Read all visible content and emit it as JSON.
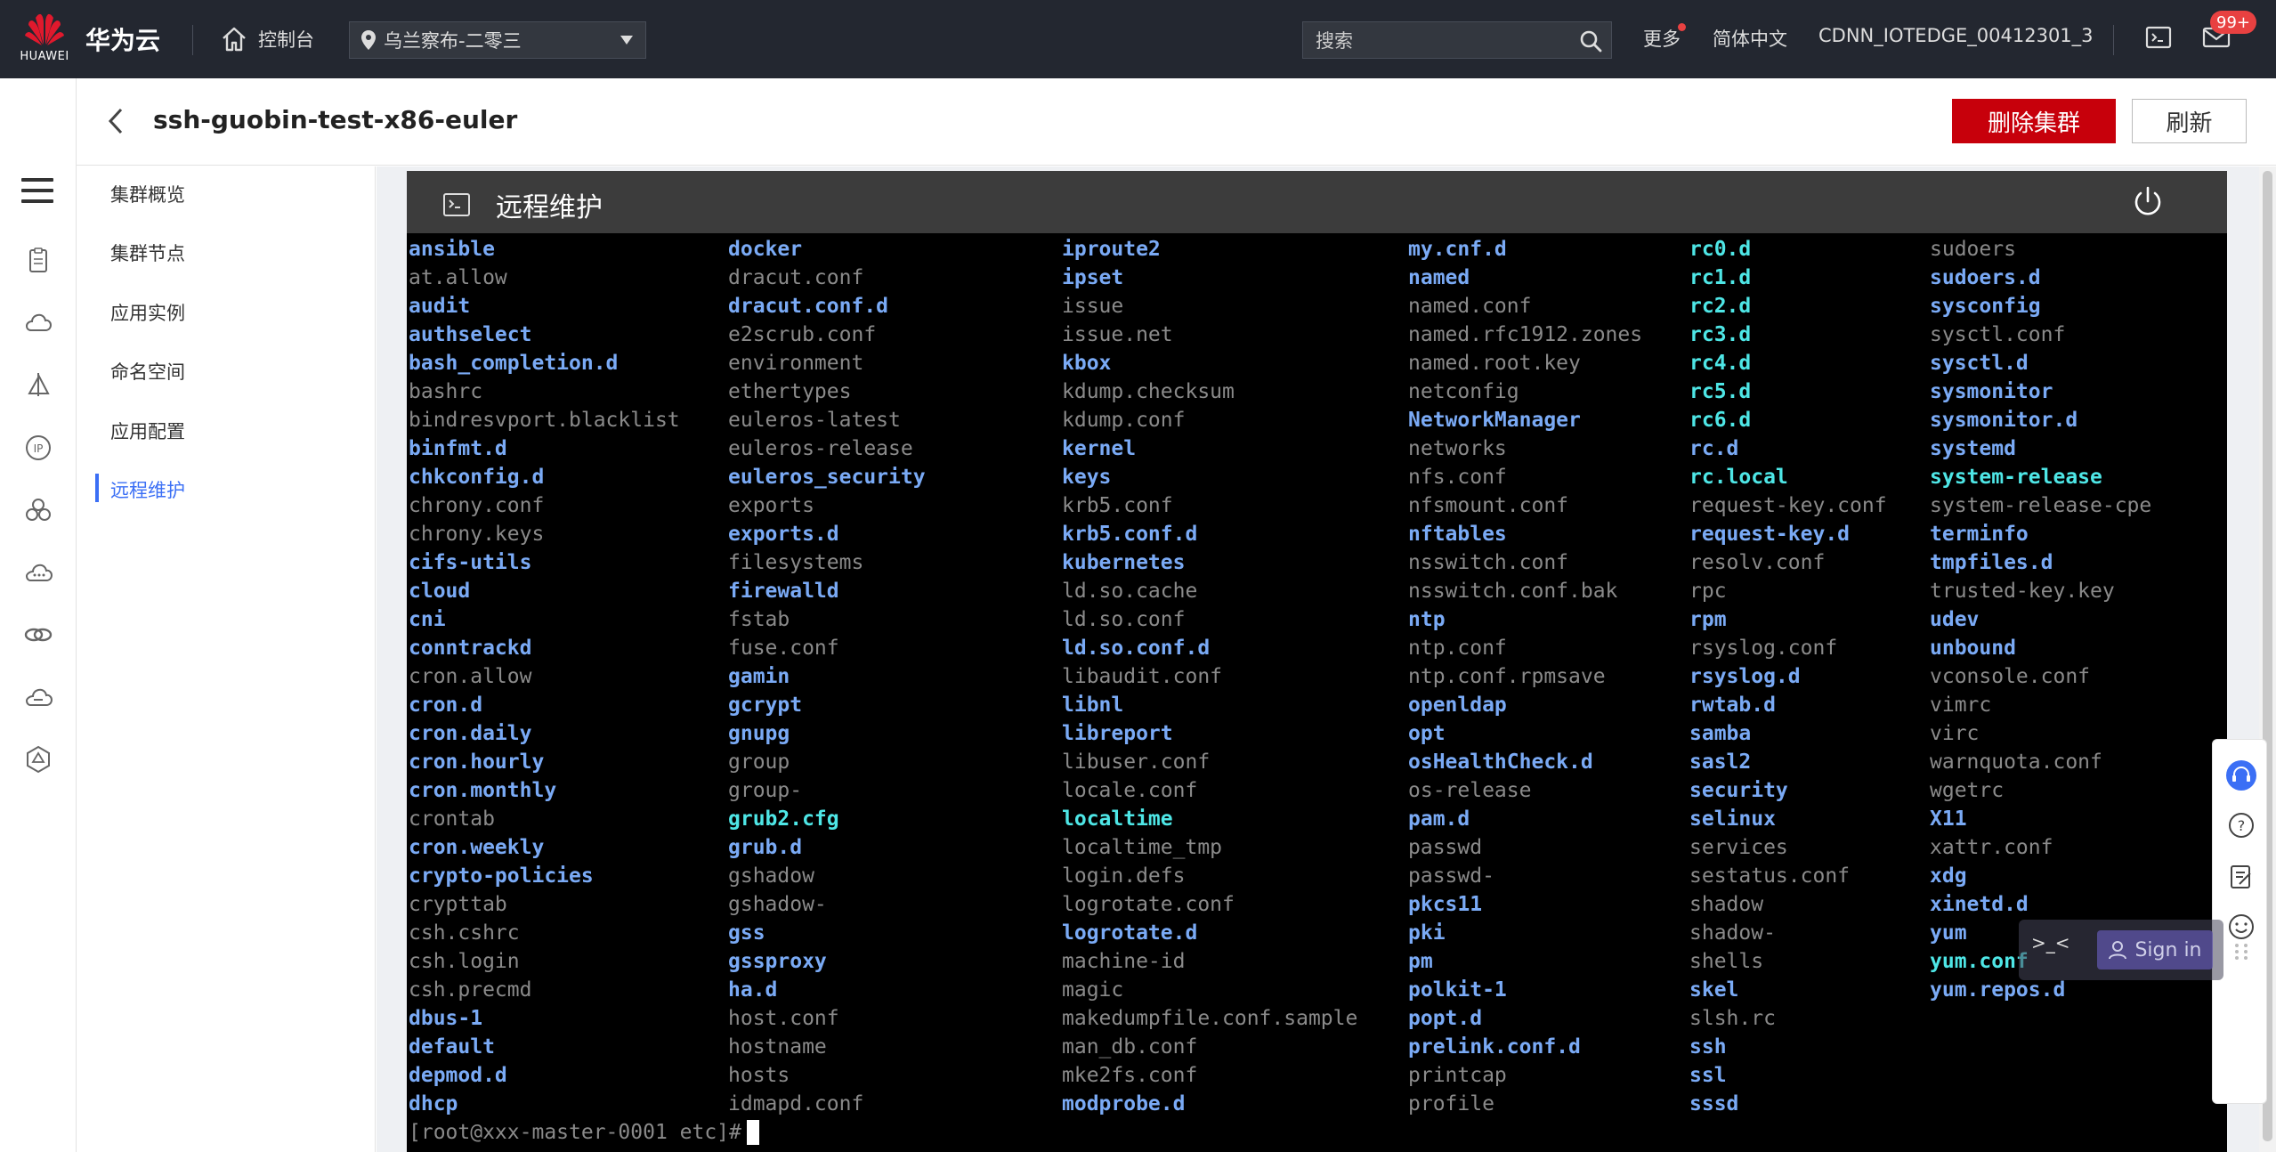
{
  "topbar": {
    "brand_text": "HUAWEI",
    "product": "华为云",
    "console_label": "控制台",
    "region": "乌兰察布-二零三",
    "search_placeholder": "搜索",
    "more_label": "更多",
    "language": "简体中文",
    "account": "CDNN_IOTEDGE_00412301_3",
    "mail_badge": "99+"
  },
  "header": {
    "title": "ssh-guobin-test-x86-euler",
    "delete_button": "删除集群",
    "refresh_button": "刷新"
  },
  "subnav": {
    "items": [
      "集群概览",
      "集群节点",
      "应用实例",
      "命名空间",
      "应用配置",
      "远程维护"
    ],
    "active_index": 5
  },
  "terminal": {
    "panel_title": "远程维护",
    "columns": [
      [
        {
          "name": "ansible",
          "kind": "d"
        },
        {
          "name": "at.allow",
          "kind": "f"
        },
        {
          "name": "audit",
          "kind": "d"
        },
        {
          "name": "authselect",
          "kind": "d"
        },
        {
          "name": "bash_completion.d",
          "kind": "d"
        },
        {
          "name": "bashrc",
          "kind": "f"
        },
        {
          "name": "bindresvport.blacklist",
          "kind": "f"
        },
        {
          "name": "binfmt.d",
          "kind": "d"
        },
        {
          "name": "chkconfig.d",
          "kind": "d"
        },
        {
          "name": "chrony.conf",
          "kind": "f"
        },
        {
          "name": "chrony.keys",
          "kind": "f"
        },
        {
          "name": "cifs-utils",
          "kind": "d"
        },
        {
          "name": "cloud",
          "kind": "d"
        },
        {
          "name": "cni",
          "kind": "d"
        },
        {
          "name": "conntrackd",
          "kind": "d"
        },
        {
          "name": "cron.allow",
          "kind": "f"
        },
        {
          "name": "cron.d",
          "kind": "d"
        },
        {
          "name": "cron.daily",
          "kind": "d"
        },
        {
          "name": "cron.hourly",
          "kind": "d"
        },
        {
          "name": "cron.monthly",
          "kind": "d"
        },
        {
          "name": "crontab",
          "kind": "f"
        },
        {
          "name": "cron.weekly",
          "kind": "d"
        },
        {
          "name": "crypto-policies",
          "kind": "d"
        },
        {
          "name": "crypttab",
          "kind": "f"
        },
        {
          "name": "csh.cshrc",
          "kind": "f"
        },
        {
          "name": "csh.login",
          "kind": "f"
        },
        {
          "name": "csh.precmd",
          "kind": "f"
        },
        {
          "name": "dbus-1",
          "kind": "d"
        },
        {
          "name": "default",
          "kind": "d"
        },
        {
          "name": "depmod.d",
          "kind": "d"
        },
        {
          "name": "dhcp",
          "kind": "d"
        }
      ],
      [
        {
          "name": "docker",
          "kind": "d"
        },
        {
          "name": "dracut.conf",
          "kind": "f"
        },
        {
          "name": "dracut.conf.d",
          "kind": "d"
        },
        {
          "name": "e2scrub.conf",
          "kind": "f"
        },
        {
          "name": "environment",
          "kind": "f"
        },
        {
          "name": "ethertypes",
          "kind": "f"
        },
        {
          "name": "euleros-latest",
          "kind": "f"
        },
        {
          "name": "euleros-release",
          "kind": "f"
        },
        {
          "name": "euleros_security",
          "kind": "d"
        },
        {
          "name": "exports",
          "kind": "f"
        },
        {
          "name": "exports.d",
          "kind": "d"
        },
        {
          "name": "filesystems",
          "kind": "f"
        },
        {
          "name": "firewalld",
          "kind": "d"
        },
        {
          "name": "fstab",
          "kind": "f"
        },
        {
          "name": "fuse.conf",
          "kind": "f"
        },
        {
          "name": "gamin",
          "kind": "d"
        },
        {
          "name": "gcrypt",
          "kind": "d"
        },
        {
          "name": "gnupg",
          "kind": "d"
        },
        {
          "name": "group",
          "kind": "f"
        },
        {
          "name": "group-",
          "kind": "f"
        },
        {
          "name": "grub2.cfg",
          "kind": "l"
        },
        {
          "name": "grub.d",
          "kind": "d"
        },
        {
          "name": "gshadow",
          "kind": "f"
        },
        {
          "name": "gshadow-",
          "kind": "f"
        },
        {
          "name": "gss",
          "kind": "d"
        },
        {
          "name": "gssproxy",
          "kind": "d"
        },
        {
          "name": "ha.d",
          "kind": "d"
        },
        {
          "name": "host.conf",
          "kind": "f"
        },
        {
          "name": "hostname",
          "kind": "f"
        },
        {
          "name": "hosts",
          "kind": "f"
        },
        {
          "name": "idmapd.conf",
          "kind": "f"
        }
      ],
      [
        {
          "name": "iproute2",
          "kind": "d"
        },
        {
          "name": "ipset",
          "kind": "d"
        },
        {
          "name": "issue",
          "kind": "f"
        },
        {
          "name": "issue.net",
          "kind": "f"
        },
        {
          "name": "kbox",
          "kind": "d"
        },
        {
          "name": "kdump.checksum",
          "kind": "f"
        },
        {
          "name": "kdump.conf",
          "kind": "f"
        },
        {
          "name": "kernel",
          "kind": "d"
        },
        {
          "name": "keys",
          "kind": "d"
        },
        {
          "name": "krb5.conf",
          "kind": "f"
        },
        {
          "name": "krb5.conf.d",
          "kind": "d"
        },
        {
          "name": "kubernetes",
          "kind": "d"
        },
        {
          "name": "ld.so.cache",
          "kind": "f"
        },
        {
          "name": "ld.so.conf",
          "kind": "f"
        },
        {
          "name": "ld.so.conf.d",
          "kind": "d"
        },
        {
          "name": "libaudit.conf",
          "kind": "f"
        },
        {
          "name": "libnl",
          "kind": "d"
        },
        {
          "name": "libreport",
          "kind": "d"
        },
        {
          "name": "libuser.conf",
          "kind": "f"
        },
        {
          "name": "locale.conf",
          "kind": "f"
        },
        {
          "name": "localtime",
          "kind": "l"
        },
        {
          "name": "localtime_tmp",
          "kind": "f"
        },
        {
          "name": "login.defs",
          "kind": "f"
        },
        {
          "name": "logrotate.conf",
          "kind": "f"
        },
        {
          "name": "logrotate.d",
          "kind": "d"
        },
        {
          "name": "machine-id",
          "kind": "f"
        },
        {
          "name": "magic",
          "kind": "f"
        },
        {
          "name": "makedumpfile.conf.sample",
          "kind": "f"
        },
        {
          "name": "man_db.conf",
          "kind": "f"
        },
        {
          "name": "mke2fs.conf",
          "kind": "f"
        },
        {
          "name": "modprobe.d",
          "kind": "d"
        }
      ],
      [
        {
          "name": "my.cnf.d",
          "kind": "d"
        },
        {
          "name": "named",
          "kind": "d"
        },
        {
          "name": "named.conf",
          "kind": "f"
        },
        {
          "name": "named.rfc1912.zones",
          "kind": "f"
        },
        {
          "name": "named.root.key",
          "kind": "f"
        },
        {
          "name": "netconfig",
          "kind": "f"
        },
        {
          "name": "NetworkManager",
          "kind": "d"
        },
        {
          "name": "networks",
          "kind": "f"
        },
        {
          "name": "nfs.conf",
          "kind": "f"
        },
        {
          "name": "nfsmount.conf",
          "kind": "f"
        },
        {
          "name": "nftables",
          "kind": "d"
        },
        {
          "name": "nsswitch.conf",
          "kind": "f"
        },
        {
          "name": "nsswitch.conf.bak",
          "kind": "f"
        },
        {
          "name": "ntp",
          "kind": "d"
        },
        {
          "name": "ntp.conf",
          "kind": "f"
        },
        {
          "name": "ntp.conf.rpmsave",
          "kind": "f"
        },
        {
          "name": "openldap",
          "kind": "d"
        },
        {
          "name": "opt",
          "kind": "d"
        },
        {
          "name": "osHealthCheck.d",
          "kind": "d"
        },
        {
          "name": "os-release",
          "kind": "f"
        },
        {
          "name": "pam.d",
          "kind": "d"
        },
        {
          "name": "passwd",
          "kind": "f"
        },
        {
          "name": "passwd-",
          "kind": "f"
        },
        {
          "name": "pkcs11",
          "kind": "d"
        },
        {
          "name": "pki",
          "kind": "d"
        },
        {
          "name": "pm",
          "kind": "d"
        },
        {
          "name": "polkit-1",
          "kind": "d"
        },
        {
          "name": "popt.d",
          "kind": "d"
        },
        {
          "name": "prelink.conf.d",
          "kind": "d"
        },
        {
          "name": "printcap",
          "kind": "f"
        },
        {
          "name": "profile",
          "kind": "f"
        }
      ],
      [
        {
          "name": "rc0.d",
          "kind": "l"
        },
        {
          "name": "rc1.d",
          "kind": "l"
        },
        {
          "name": "rc2.d",
          "kind": "l"
        },
        {
          "name": "rc3.d",
          "kind": "l"
        },
        {
          "name": "rc4.d",
          "kind": "l"
        },
        {
          "name": "rc5.d",
          "kind": "l"
        },
        {
          "name": "rc6.d",
          "kind": "l"
        },
        {
          "name": "rc.d",
          "kind": "d"
        },
        {
          "name": "rc.local",
          "kind": "l"
        },
        {
          "name": "request-key.conf",
          "kind": "f"
        },
        {
          "name": "request-key.d",
          "kind": "d"
        },
        {
          "name": "resolv.conf",
          "kind": "f"
        },
        {
          "name": "rpc",
          "kind": "f"
        },
        {
          "name": "rpm",
          "kind": "d"
        },
        {
          "name": "rsyslog.conf",
          "kind": "f"
        },
        {
          "name": "rsyslog.d",
          "kind": "d"
        },
        {
          "name": "rwtab.d",
          "kind": "d"
        },
        {
          "name": "samba",
          "kind": "d"
        },
        {
          "name": "sasl2",
          "kind": "d"
        },
        {
          "name": "security",
          "kind": "d"
        },
        {
          "name": "selinux",
          "kind": "d"
        },
        {
          "name": "services",
          "kind": "f"
        },
        {
          "name": "sestatus.conf",
          "kind": "f"
        },
        {
          "name": "shadow",
          "kind": "f"
        },
        {
          "name": "shadow-",
          "kind": "f"
        },
        {
          "name": "shells",
          "kind": "f"
        },
        {
          "name": "skel",
          "kind": "d"
        },
        {
          "name": "slsh.rc",
          "kind": "f"
        },
        {
          "name": "ssh",
          "kind": "d"
        },
        {
          "name": "ssl",
          "kind": "d"
        },
        {
          "name": "sssd",
          "kind": "d"
        }
      ],
      [
        {
          "name": "sudoers",
          "kind": "f"
        },
        {
          "name": "sudoers.d",
          "kind": "d"
        },
        {
          "name": "sysconfig",
          "kind": "d"
        },
        {
          "name": "sysctl.conf",
          "kind": "f"
        },
        {
          "name": "sysctl.d",
          "kind": "d"
        },
        {
          "name": "sysmonitor",
          "kind": "d"
        },
        {
          "name": "sysmonitor.d",
          "kind": "d"
        },
        {
          "name": "systemd",
          "kind": "d"
        },
        {
          "name": "system-release",
          "kind": "l"
        },
        {
          "name": "system-release-cpe",
          "kind": "f"
        },
        {
          "name": "terminfo",
          "kind": "d"
        },
        {
          "name": "tmpfiles.d",
          "kind": "d"
        },
        {
          "name": "trusted-key.key",
          "kind": "f"
        },
        {
          "name": "udev",
          "kind": "d"
        },
        {
          "name": "unbound",
          "kind": "d"
        },
        {
          "name": "vconsole.conf",
          "kind": "f"
        },
        {
          "name": "vimrc",
          "kind": "f"
        },
        {
          "name": "virc",
          "kind": "f"
        },
        {
          "name": "warnquota.conf",
          "kind": "f"
        },
        {
          "name": "wgetrc",
          "kind": "f"
        },
        {
          "name": "X11",
          "kind": "d"
        },
        {
          "name": "xattr.conf",
          "kind": "f"
        },
        {
          "name": "xdg",
          "kind": "d"
        },
        {
          "name": "xinetd.d",
          "kind": "d"
        },
        {
          "name": "yum",
          "kind": "d"
        },
        {
          "name": "yum.conf",
          "kind": "l"
        },
        {
          "name": "yum.repos.d",
          "kind": "d"
        }
      ]
    ],
    "prompt": "[root@xxx-master-0001 etc]#"
  },
  "floating": {
    "signin_label": "Sign in",
    "face_glyph": ">_<"
  },
  "colors": {
    "topbar_bg": "#232730",
    "accent_red": "#c7000b",
    "active_blue": "#3b6ff5",
    "dir_blue": "#7aaaf5",
    "link_cyan": "#4ee6e6",
    "file_gray": "#8a8a8a"
  }
}
